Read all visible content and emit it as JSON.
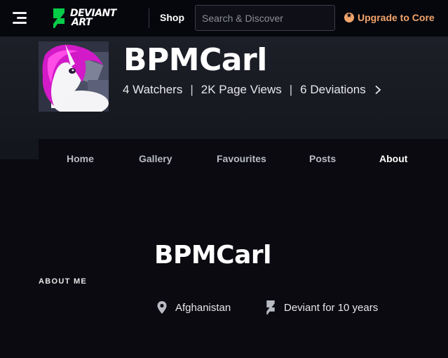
{
  "topbar": {
    "logo_line1": "DEVIANT",
    "logo_line2": "ART",
    "shop_label": "Shop",
    "search_placeholder": "Search & Discover",
    "upgrade_label": "Upgrade to Core"
  },
  "profile": {
    "username": "BPMCarl",
    "stats": {
      "watchers": "4 Watchers",
      "page_views": "2K Page Views",
      "deviations": "6 Deviations",
      "separator": "|"
    }
  },
  "tabs": [
    {
      "label": "Home",
      "active": false
    },
    {
      "label": "Gallery",
      "active": false
    },
    {
      "label": "Favourites",
      "active": false
    },
    {
      "label": "Posts",
      "active": false
    },
    {
      "label": "About",
      "active": true
    }
  ],
  "about": {
    "username": "BPMCarl",
    "section_label": "ABOUT ME",
    "location": "Afghanistan",
    "membership": "Deviant for 10 years"
  },
  "icons": {
    "menu": "hamburger-icon",
    "search": "search-icon",
    "core": "core-badge-icon",
    "chevron": "chevron-right-icon",
    "location": "location-pin-icon",
    "deviant": "deviantart-logo-icon"
  },
  "colors": {
    "background": "#0a0a10",
    "topbar": "#06070d",
    "brand_green": "#05cc47",
    "upgrade_accent": "#f2a46b",
    "tab_inactive": "#b9bbc3",
    "text": "#e8e8ea"
  }
}
